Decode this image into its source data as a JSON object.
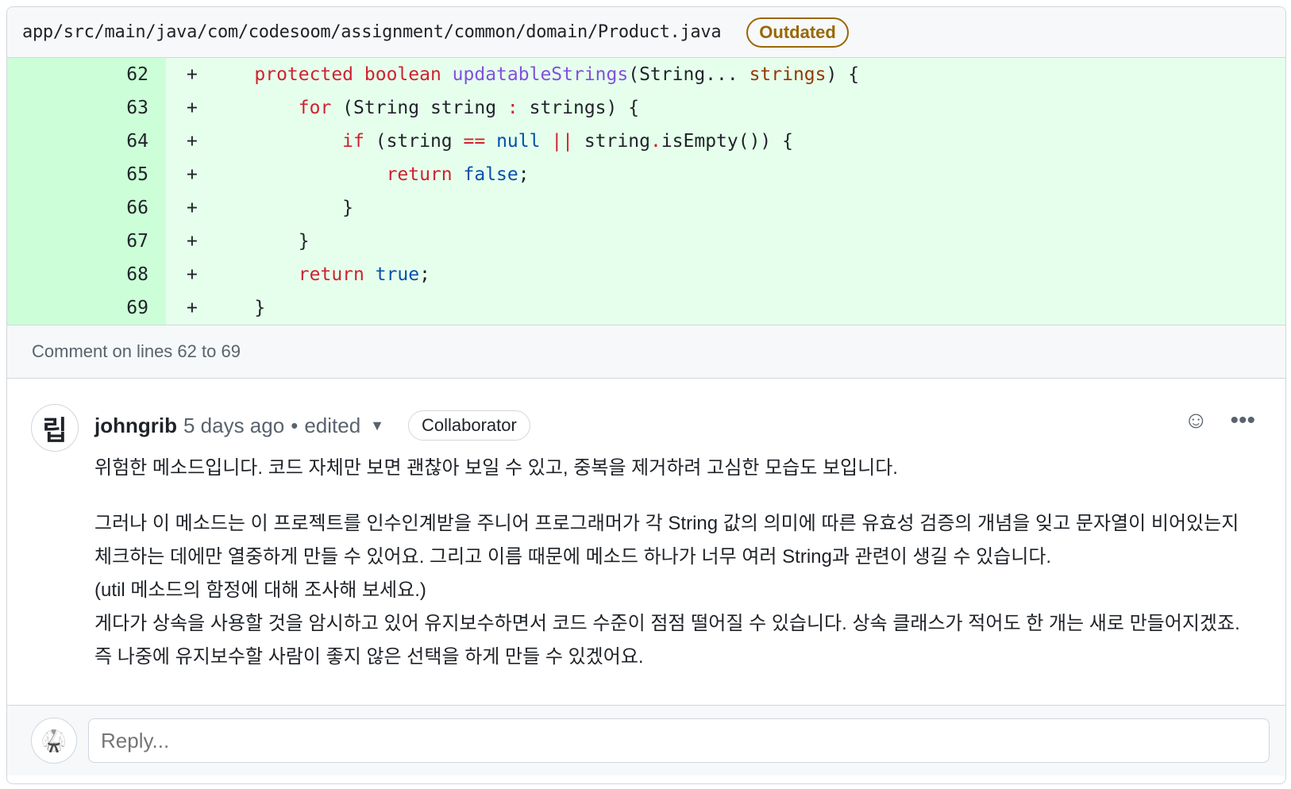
{
  "file": {
    "path": "app/src/main/java/com/codesoom/assignment/common/domain/Product.java",
    "badge": "Outdated"
  },
  "code": [
    {
      "line": "62",
      "sign": "+",
      "parts": [
        [
          "    ",
          ""
        ],
        [
          "protected",
          "k"
        ],
        [
          " ",
          ""
        ],
        [
          "boolean",
          "k"
        ],
        [
          " ",
          ""
        ],
        [
          "updatableStrings",
          "f"
        ],
        [
          "(String... ",
          ""
        ],
        [
          "strings",
          "v"
        ],
        [
          ") {",
          ""
        ]
      ]
    },
    {
      "line": "63",
      "sign": "+",
      "parts": [
        [
          "        ",
          ""
        ],
        [
          "for",
          "k"
        ],
        [
          " (String string ",
          ""
        ],
        [
          ":",
          "k"
        ],
        [
          " strings) {",
          ""
        ]
      ]
    },
    {
      "line": "64",
      "sign": "+",
      "parts": [
        [
          "            ",
          ""
        ],
        [
          "if",
          "k"
        ],
        [
          " (string ",
          ""
        ],
        [
          "==",
          "k"
        ],
        [
          " ",
          ""
        ],
        [
          "null",
          "c"
        ],
        [
          " ",
          ""
        ],
        [
          "||",
          "k"
        ],
        [
          " string",
          ""
        ],
        [
          ".",
          "k"
        ],
        [
          "isEmpty()) {",
          ""
        ]
      ]
    },
    {
      "line": "65",
      "sign": "+",
      "parts": [
        [
          "                ",
          ""
        ],
        [
          "return",
          "k"
        ],
        [
          " ",
          ""
        ],
        [
          "false",
          "c"
        ],
        [
          ";",
          ""
        ]
      ]
    },
    {
      "line": "66",
      "sign": "+",
      "parts": [
        [
          "            }",
          ""
        ]
      ]
    },
    {
      "line": "67",
      "sign": "+",
      "parts": [
        [
          "        }",
          ""
        ]
      ]
    },
    {
      "line": "68",
      "sign": "+",
      "parts": [
        [
          "        ",
          ""
        ],
        [
          "return",
          "k"
        ],
        [
          " ",
          ""
        ],
        [
          "true",
          "c"
        ],
        [
          ";",
          ""
        ]
      ]
    },
    {
      "line": "69",
      "sign": "+",
      "parts": [
        [
          "    }",
          ""
        ]
      ]
    }
  ],
  "comment_lines": "Comment on lines 62 to 69",
  "comment": {
    "avatar_text": "립",
    "author": "johngrib",
    "time": "5 days ago",
    "sep": "•",
    "edited": "edited",
    "role": "Collaborator",
    "p1": "위험한 메소드입니다. 코드 자체만 보면 괜찮아 보일 수 있고, 중복을 제거하려 고심한 모습도 보입니다.",
    "p2a": "그러나 이 메소드는 이 프로젝트를 인수인계받을 주니어 프로그래머가 각 String 값의 의미에 따른 유효성 검증의 개념을 잊고 문자열이 비어있는지 체크하는 데에만 열중하게 만들 수 있어요. 그리고 이름 때문에 메소드 하나가 너무 여러 String과 관련이 생길 수 있습니다.",
    "p2b": "(util 메소드의 함정에 대해 조사해 보세요.)",
    "p2c": "게다가 상속을 사용할 것을 암시하고 있어 유지보수하면서 코드 수준이 점점 떨어질 수 있습니다. 상속 클래스가 적어도 한 개는 새로 만들어지겠죠. 즉 나중에 유지보수할 사람이 좋지 않은 선택을 하게 만들 수 있겠어요."
  },
  "reply": {
    "placeholder": "Reply..."
  }
}
